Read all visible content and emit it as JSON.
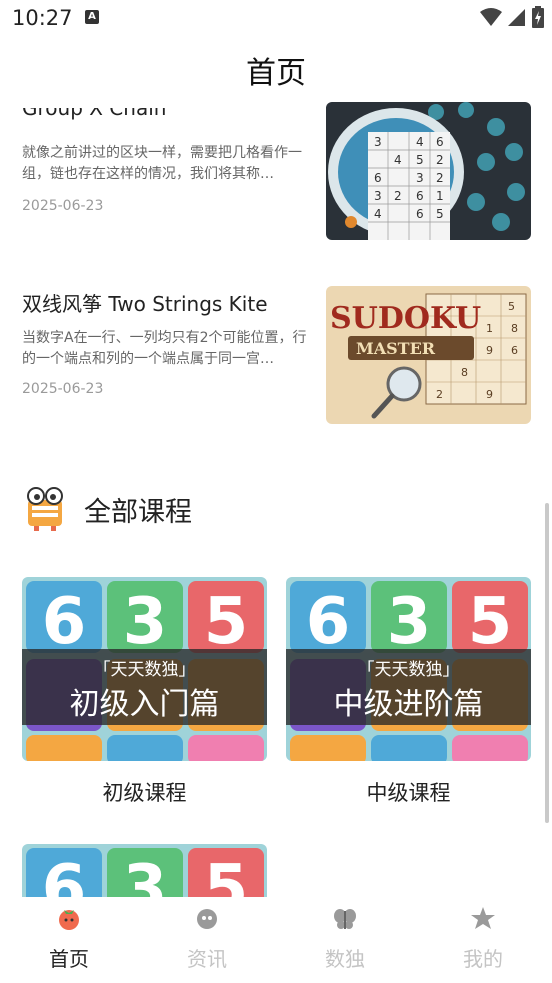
{
  "status_bar": {
    "time": "10:27",
    "notification_badge": "A"
  },
  "header": {
    "title": "首页"
  },
  "articles": [
    {
      "title": "Group X Chain",
      "desc": "就像之前讲过的区块一样，需要把几格看作一组，链也存在这样的情况，我们将其称…",
      "date": "2025-06-23"
    },
    {
      "title": "双线风筝 Two Strings Kite",
      "desc": "当数字A在一行、一列均只有2个可能位置，行的一个端点和列的一个端点属于同一宫…",
      "date": "2025-06-23",
      "thumb_text": {
        "sudoku": "SUDOKU",
        "master": "MASTER"
      }
    }
  ],
  "courses_section": {
    "title": "全部课程"
  },
  "courses": [
    {
      "banner_small": "「天天数独」",
      "banner_big": "初级入门篇",
      "label": "初级课程"
    },
    {
      "banner_small": "「天天数独」",
      "banner_big": "中级进阶篇",
      "label": "中级课程"
    }
  ],
  "tabs": [
    {
      "label": "首页",
      "icon": "tomato-icon",
      "active": true
    },
    {
      "label": "资讯",
      "icon": "news-icon",
      "active": false
    },
    {
      "label": "数独",
      "icon": "butterfly-icon",
      "active": false
    },
    {
      "label": "我的",
      "icon": "star-icon",
      "active": false
    }
  ],
  "colors": {
    "tile_blue": "#4fa9d8",
    "tile_green": "#5cc17a",
    "tile_red": "#e8676a",
    "tile_purple": "#7b56c9",
    "accent_orange": "#f4a742"
  }
}
